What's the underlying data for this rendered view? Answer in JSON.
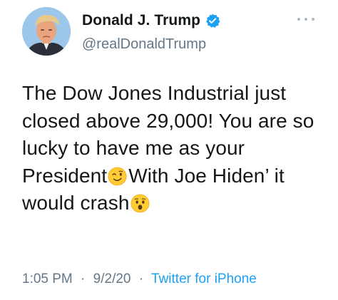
{
  "tweet": {
    "display_name": "Donald J. Trump",
    "handle": "@realDonaldTrump",
    "text": {
      "part1": "The Dow Jones Industrial just closed above 29,000! You are so lucky to have me as your President",
      "part2": "With Joe Hiden’ it would crash"
    },
    "time": "1:05 PM",
    "separator": "·",
    "date": "9/2/20",
    "source": "Twitter for iPhone"
  },
  "icons": {
    "verified": "verified-badge-icon",
    "more": "more-options-icon",
    "emoji_1": "winking-face-emoji",
    "emoji_2": "hushed-face-emoji"
  },
  "colors": {
    "text": "#14171a",
    "secondary": "#657786",
    "accent": "#1da1f2",
    "avatar_bg": "#9dc7ea"
  }
}
